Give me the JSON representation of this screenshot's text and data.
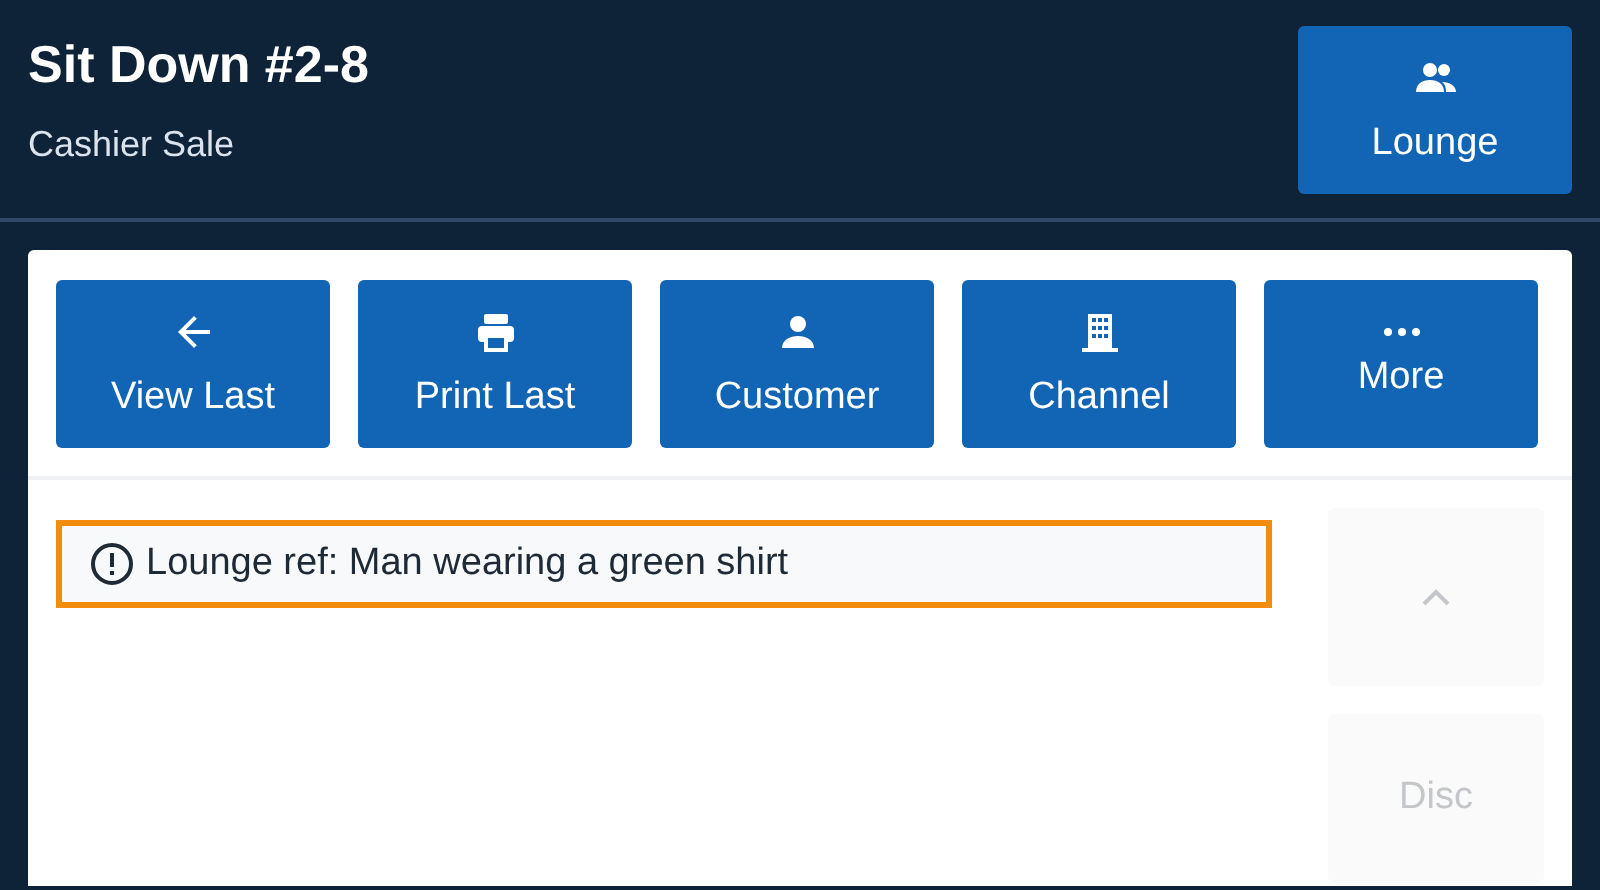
{
  "header": {
    "title": "Sit Down #2-8",
    "subtitle": "Cashier Sale",
    "action": {
      "label": "Lounge",
      "kind": "people"
    }
  },
  "actions": [
    {
      "label": "View Last",
      "kind": "arrow"
    },
    {
      "label": "Print Last",
      "kind": "printer"
    },
    {
      "label": "Customer",
      "kind": "person"
    },
    {
      "label": "Channel",
      "kind": "building"
    },
    {
      "label": "More",
      "kind": "dots"
    }
  ],
  "note": {
    "text": "Lounge ref: Man wearing a green shirt"
  },
  "side_buttons": [
    {
      "kind": "scroll-up",
      "disabled": true
    },
    {
      "kind": "text",
      "label": "Disc",
      "disabled": true
    }
  ]
}
